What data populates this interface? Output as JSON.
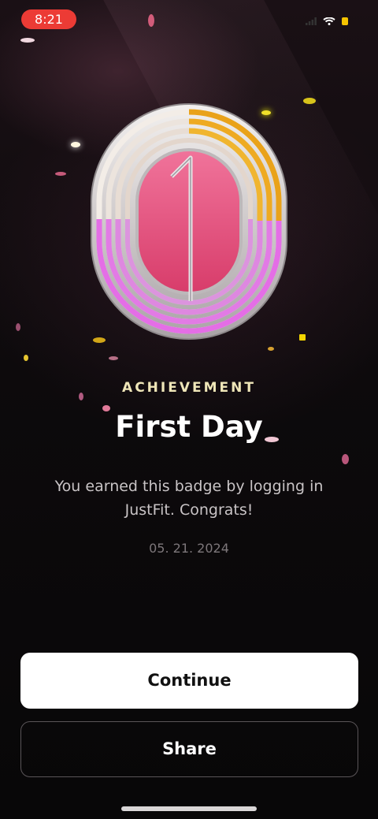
{
  "status_bar": {
    "time": "8:21"
  },
  "badge": {
    "numeral": "1",
    "icon": "first-day-badge-icon"
  },
  "achievement": {
    "label": "ACHIEVEMENT",
    "title": "First Day",
    "description": "You earned this badge by logging in JustFit. Congrats!",
    "date": "05. 21. 2024"
  },
  "buttons": {
    "continue": "Continue",
    "share": "Share"
  },
  "colors": {
    "accent_pink": "#e8587f",
    "accent_gold": "#e9a21a",
    "status_red": "#ec3b35"
  }
}
